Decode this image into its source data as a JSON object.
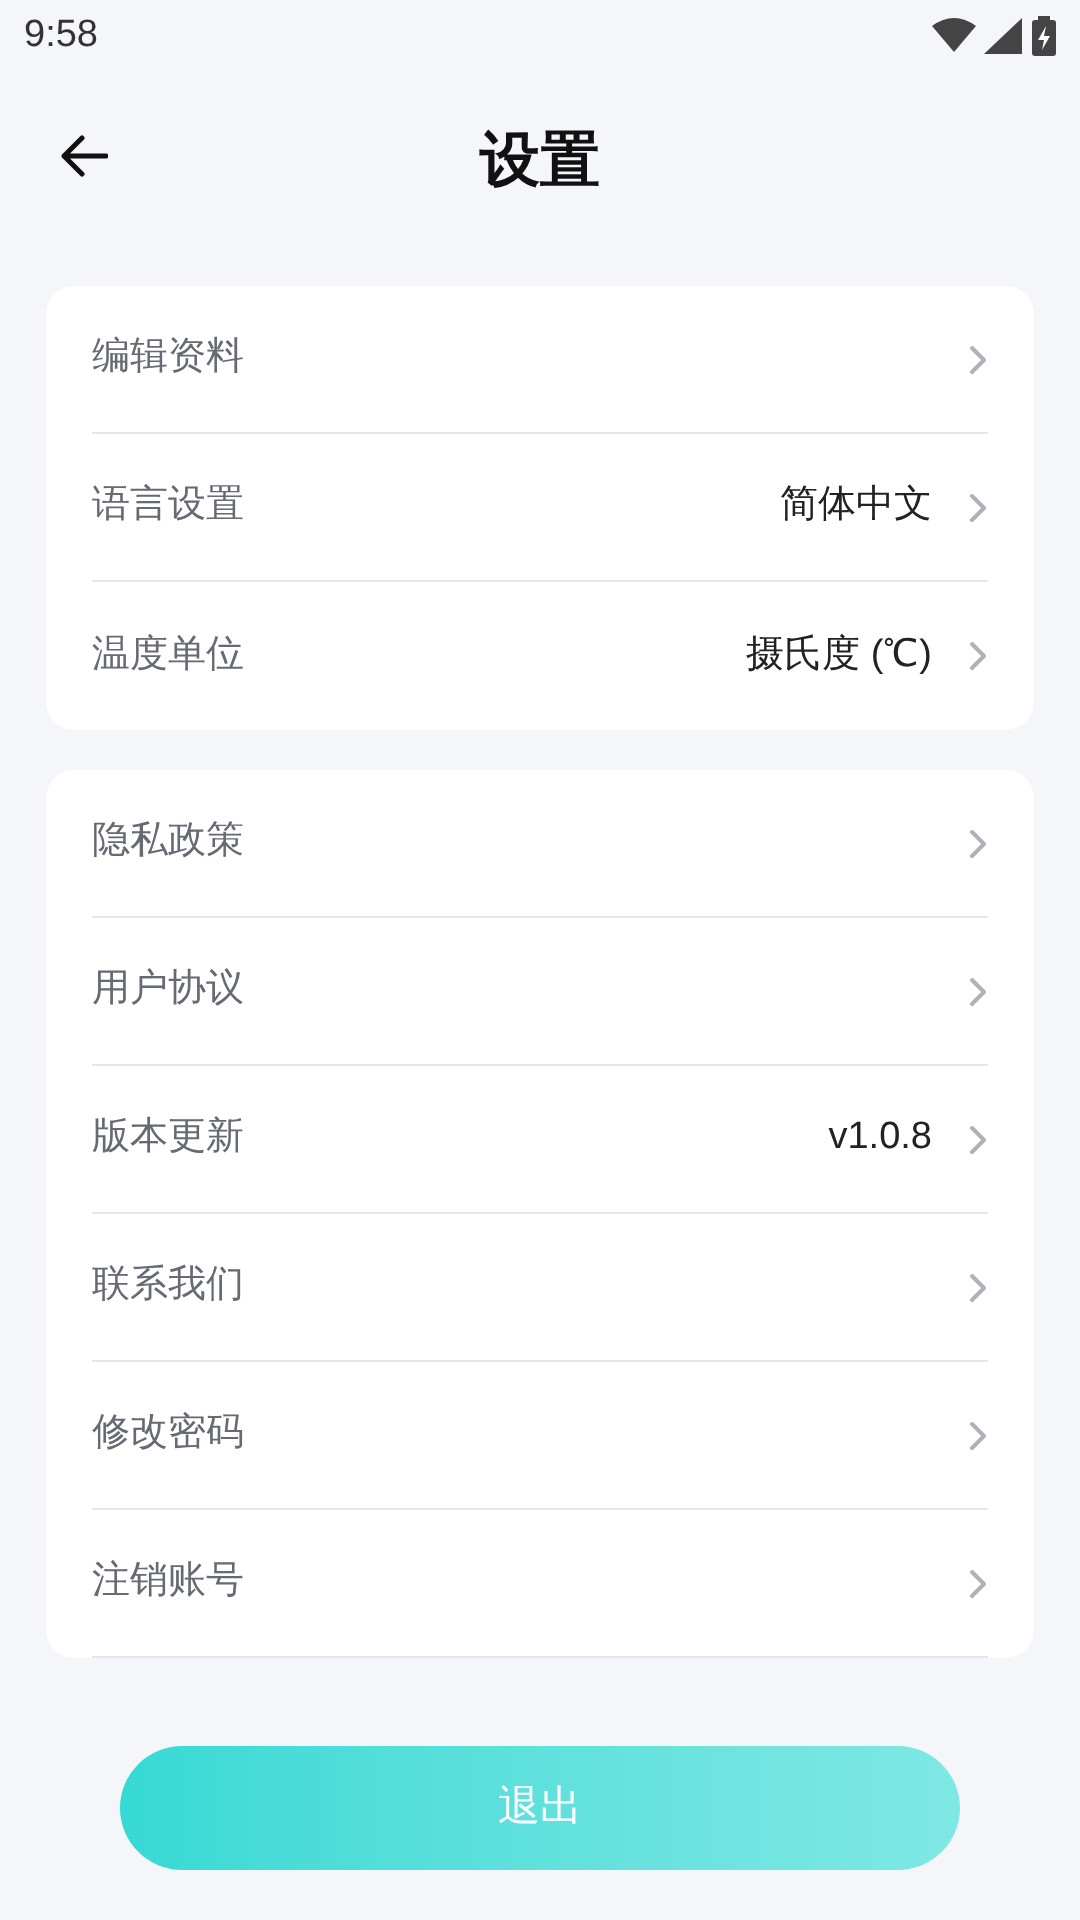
{
  "status_bar": {
    "time": "9:58"
  },
  "header": {
    "title": "设置"
  },
  "groups": [
    {
      "items": [
        {
          "label": "编辑资料"
        },
        {
          "label": "语言设置",
          "value": "简体中文"
        },
        {
          "label": "温度单位",
          "value": "摄氏度 (℃)"
        }
      ]
    },
    {
      "items": [
        {
          "label": "隐私政策"
        },
        {
          "label": "用户协议"
        },
        {
          "label": "版本更新",
          "value": "v1.0.8"
        },
        {
          "label": "联系我们"
        },
        {
          "label": "修改密码"
        },
        {
          "label": "注销账号"
        }
      ]
    }
  ],
  "logout_button": {
    "label": "退出"
  }
}
